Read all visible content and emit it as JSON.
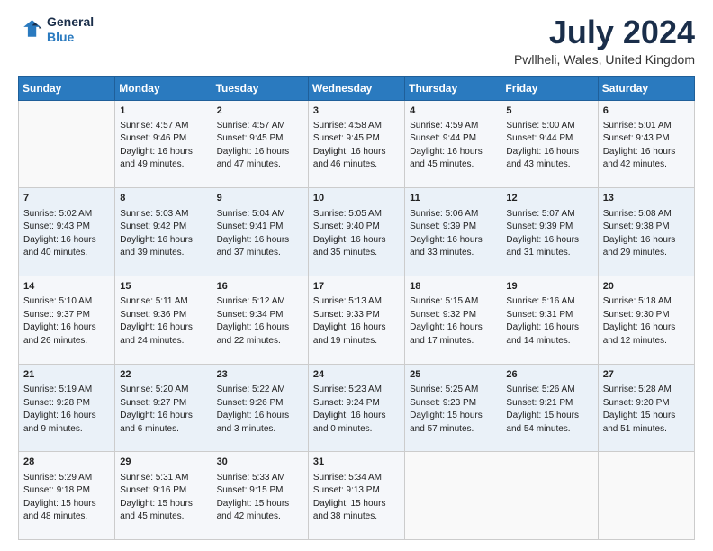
{
  "header": {
    "logo_general": "General",
    "logo_blue": "Blue",
    "month_title": "July 2024",
    "location": "Pwllheli, Wales, United Kingdom"
  },
  "weekdays": [
    "Sunday",
    "Monday",
    "Tuesday",
    "Wednesday",
    "Thursday",
    "Friday",
    "Saturday"
  ],
  "weeks": [
    [
      {
        "day": "",
        "text": ""
      },
      {
        "day": "1",
        "text": "Sunrise: 4:57 AM\nSunset: 9:46 PM\nDaylight: 16 hours\nand 49 minutes."
      },
      {
        "day": "2",
        "text": "Sunrise: 4:57 AM\nSunset: 9:45 PM\nDaylight: 16 hours\nand 47 minutes."
      },
      {
        "day": "3",
        "text": "Sunrise: 4:58 AM\nSunset: 9:45 PM\nDaylight: 16 hours\nand 46 minutes."
      },
      {
        "day": "4",
        "text": "Sunrise: 4:59 AM\nSunset: 9:44 PM\nDaylight: 16 hours\nand 45 minutes."
      },
      {
        "day": "5",
        "text": "Sunrise: 5:00 AM\nSunset: 9:44 PM\nDaylight: 16 hours\nand 43 minutes."
      },
      {
        "day": "6",
        "text": "Sunrise: 5:01 AM\nSunset: 9:43 PM\nDaylight: 16 hours\nand 42 minutes."
      }
    ],
    [
      {
        "day": "7",
        "text": "Sunrise: 5:02 AM\nSunset: 9:43 PM\nDaylight: 16 hours\nand 40 minutes."
      },
      {
        "day": "8",
        "text": "Sunrise: 5:03 AM\nSunset: 9:42 PM\nDaylight: 16 hours\nand 39 minutes."
      },
      {
        "day": "9",
        "text": "Sunrise: 5:04 AM\nSunset: 9:41 PM\nDaylight: 16 hours\nand 37 minutes."
      },
      {
        "day": "10",
        "text": "Sunrise: 5:05 AM\nSunset: 9:40 PM\nDaylight: 16 hours\nand 35 minutes."
      },
      {
        "day": "11",
        "text": "Sunrise: 5:06 AM\nSunset: 9:39 PM\nDaylight: 16 hours\nand 33 minutes."
      },
      {
        "day": "12",
        "text": "Sunrise: 5:07 AM\nSunset: 9:39 PM\nDaylight: 16 hours\nand 31 minutes."
      },
      {
        "day": "13",
        "text": "Sunrise: 5:08 AM\nSunset: 9:38 PM\nDaylight: 16 hours\nand 29 minutes."
      }
    ],
    [
      {
        "day": "14",
        "text": "Sunrise: 5:10 AM\nSunset: 9:37 PM\nDaylight: 16 hours\nand 26 minutes."
      },
      {
        "day": "15",
        "text": "Sunrise: 5:11 AM\nSunset: 9:36 PM\nDaylight: 16 hours\nand 24 minutes."
      },
      {
        "day": "16",
        "text": "Sunrise: 5:12 AM\nSunset: 9:34 PM\nDaylight: 16 hours\nand 22 minutes."
      },
      {
        "day": "17",
        "text": "Sunrise: 5:13 AM\nSunset: 9:33 PM\nDaylight: 16 hours\nand 19 minutes."
      },
      {
        "day": "18",
        "text": "Sunrise: 5:15 AM\nSunset: 9:32 PM\nDaylight: 16 hours\nand 17 minutes."
      },
      {
        "day": "19",
        "text": "Sunrise: 5:16 AM\nSunset: 9:31 PM\nDaylight: 16 hours\nand 14 minutes."
      },
      {
        "day": "20",
        "text": "Sunrise: 5:18 AM\nSunset: 9:30 PM\nDaylight: 16 hours\nand 12 minutes."
      }
    ],
    [
      {
        "day": "21",
        "text": "Sunrise: 5:19 AM\nSunset: 9:28 PM\nDaylight: 16 hours\nand 9 minutes."
      },
      {
        "day": "22",
        "text": "Sunrise: 5:20 AM\nSunset: 9:27 PM\nDaylight: 16 hours\nand 6 minutes."
      },
      {
        "day": "23",
        "text": "Sunrise: 5:22 AM\nSunset: 9:26 PM\nDaylight: 16 hours\nand 3 minutes."
      },
      {
        "day": "24",
        "text": "Sunrise: 5:23 AM\nSunset: 9:24 PM\nDaylight: 16 hours\nand 0 minutes."
      },
      {
        "day": "25",
        "text": "Sunrise: 5:25 AM\nSunset: 9:23 PM\nDaylight: 15 hours\nand 57 minutes."
      },
      {
        "day": "26",
        "text": "Sunrise: 5:26 AM\nSunset: 9:21 PM\nDaylight: 15 hours\nand 54 minutes."
      },
      {
        "day": "27",
        "text": "Sunrise: 5:28 AM\nSunset: 9:20 PM\nDaylight: 15 hours\nand 51 minutes."
      }
    ],
    [
      {
        "day": "28",
        "text": "Sunrise: 5:29 AM\nSunset: 9:18 PM\nDaylight: 15 hours\nand 48 minutes."
      },
      {
        "day": "29",
        "text": "Sunrise: 5:31 AM\nSunset: 9:16 PM\nDaylight: 15 hours\nand 45 minutes."
      },
      {
        "day": "30",
        "text": "Sunrise: 5:33 AM\nSunset: 9:15 PM\nDaylight: 15 hours\nand 42 minutes."
      },
      {
        "day": "31",
        "text": "Sunrise: 5:34 AM\nSunset: 9:13 PM\nDaylight: 15 hours\nand 38 minutes."
      },
      {
        "day": "",
        "text": ""
      },
      {
        "day": "",
        "text": ""
      },
      {
        "day": "",
        "text": ""
      }
    ]
  ]
}
